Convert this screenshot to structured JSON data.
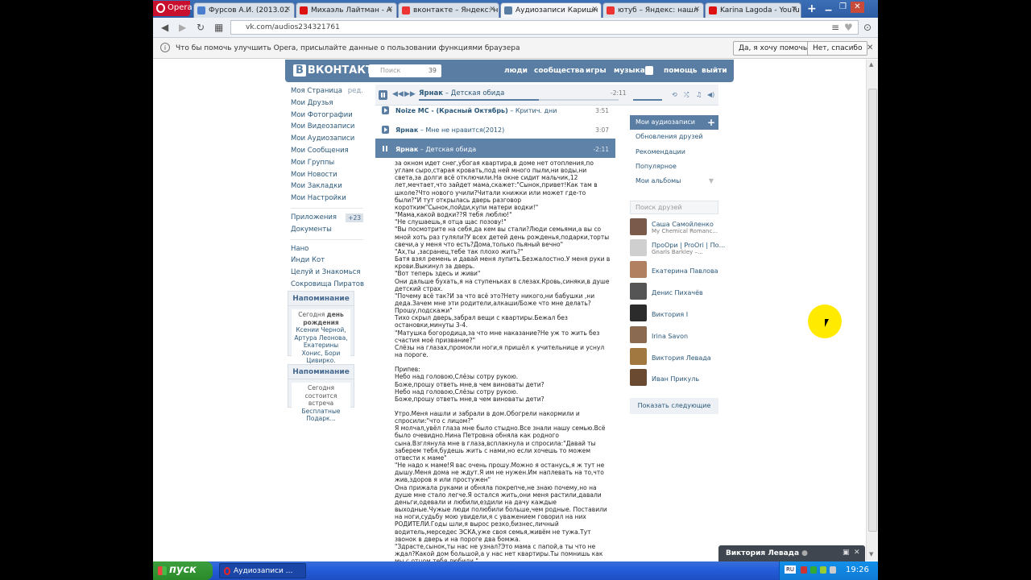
{
  "browser": {
    "menu_label": "Opera",
    "tabs": [
      {
        "title": "Фурсов А.И. (2013.02",
        "color": "#4a7fd0"
      },
      {
        "title": "Михаэль Лайтман - А",
        "color": "#d11"
      },
      {
        "title": "вконтакте – Яндекс: н",
        "color": "#e33"
      },
      {
        "title": "Аудиозаписи Каришн",
        "color": "#597da3"
      },
      {
        "title": "ютуб – Яндекс: нашл",
        "color": "#e33"
      },
      {
        "title": "Karina Lagoda - YouTu",
        "color": "#d11"
      }
    ],
    "url": "vk.com/audios234321761",
    "infobar": {
      "message": "Что бы помочь улучшить Opera, присылайте данные о пользовании функциями браузера",
      "yes_label": "Да, я хочу помочь",
      "no_label": "Нет, спасибо"
    }
  },
  "vk": {
    "logo": "ВКОНТАКТЕ",
    "logo_mark": "В",
    "search_placeholder": "Поиск",
    "search_count": "39",
    "nav": [
      "люди",
      "сообщества",
      "игры",
      "музыка",
      "помощь",
      "выйти"
    ],
    "left_menu": [
      {
        "label": "Моя Страница",
        "extra": "ред."
      },
      {
        "label": "Мои Друзья"
      },
      {
        "label": "Мои Фотографии"
      },
      {
        "label": "Мои Видеозаписи"
      },
      {
        "label": "Мои Аудиозаписи"
      },
      {
        "label": "Мои Сообщения"
      },
      {
        "label": "Мои Группы"
      },
      {
        "label": "Мои Новости"
      },
      {
        "label": "Мои Закладки"
      },
      {
        "label": "Мои Настройки"
      }
    ],
    "apps": {
      "label": "Приложения",
      "badge": "+23"
    },
    "docs": "Документы",
    "groups": [
      "Нано",
      "Инди Кот",
      "Целуй и Знакомься",
      "Сокровища Пиратов"
    ],
    "reminder1": {
      "title": "Напоминание",
      "pre": "Сегодня",
      "bold": "день рождения",
      "names": "Ксении Черной, Артура Леонова, Екатерины Хонис, Бори Цивирко."
    },
    "reminder2": {
      "title": "Напоминание",
      "text": "Сегодня состоится встреча",
      "link": "Бесплатные Подарк..."
    },
    "player": {
      "artist": "Ярнак",
      "title": "Детская обида",
      "time": "-2:11",
      "progress": 0.6
    },
    "tracks": [
      {
        "artist": "Noize MC - (Красный Октябрь)",
        "title": "Критич. дни",
        "duration": "3:51"
      },
      {
        "artist": "Ярнак",
        "title": "Мне не нравится(2012)",
        "duration": "3:07"
      },
      {
        "artist": "Ярнак",
        "title": "Детская обида",
        "duration": "-2:11"
      }
    ],
    "lyrics": [
      "за окном идет снег,убогая квартира,в доме нет отопления,по углам сыро,старая кровать,под ней много пыли,ни воды,ни света,за долги всё отключили.На окне сидит мальчик,12 лет,мечтает,что зайдет мама,скажет:\"Сынок,привет!Как там в школе?Что нового учили?Читали книжки или может где-то были?\"И тут открылась дверь разговор коротким\"Сынок,пойди,купи матери водки!\"\n\"Мама,какой водки??Я тебя люблю!\"\n\"Не слушаешь,я отца щас позову!\"\n\"Вы посмотрите на себя,да кем вы стали?Люди семьями,а вы со мной хоть раз гуляли?У всех детей день рожденья,подарки,торты свечи,а у меня что есть?Дома,только пьяный вечно\"\n\"Ах,ты ,засранец,тебе так плохо жить?\"\nБатя взял ремень и давай меня лупить.Безжалостно.У меня руки в крови.Выкинул за дверь.\n\"Вот теперь здесь и живи\"\nОни дальше бухать,я на ступеньках в слезах.Кровь,синяки,в душе детский страх.\n\"Почему всё так?И за что всё это?Нету никого,ни бабушки ,ни деда.Зачем мне эти родители,алкаши/Боже что мне делать?Прошу,подскажи\"\nТихо скрыл дверь,забрал вещи с квартиры.Бежал без остановки,минуты 3-4.\n\"Матушка богородица,за что мне наказание?Не уж то жить без счастия моё призвание?\"\nСлёзы на глазах,промокли ноги,я пришёл к учительнице и уснул на пороге.",
      "Припев:\nНебо над головою,Слёзы сотру рукою.\nБоже,прошу ответь мне,в чем виноваты дети?\nНебо над головою,Слёзы сотру рукою.\nБоже,прошу ответь мне,в чем виноваты дети?",
      "Утро.Меня нашли и забрали в дом.Обогрели накормили и спросили:\"что с лицом?\"\nЯ молчал,увёл глаза мне было стыдно.Все знали нашу семью.Всё было очевидно.Нина Петровна обняла как родного сына.Взглянула мне в глаза,всплакнула и спросила:\"Давай ты заберем тебя,будешь жить с нами,но если хочешь то можем отвести к маме\"\n\"Не надо к маме!Я вас очень прошу.Можно я останусь,я ж тут не дышу.Меня дома не ждут.Я им не нужен.Им наплевать на то,что жив,здоров я или простужен\"\nОна прижала руками и обняла покрепче,не знаю почему,но на душе мне стало легче.Я остался жить,они меня растили,давали деньги,одевали и любили,ездили на дачу каждые выходные.Чужые люди полюбили больше,чем родные. Поставили на ноги,судьбу мою увидели,я с уважением говорил на них РОДИТЕЛИ.Годы шли,я вырос резко,бизнес,личный водитель,мерседес ЭСКА,уже своя семья,живём не тужа.Тут звонок в дверь и на пороге два бомжа.\n\"Здрасте,сынок,ты нас не узнал?Это мама с папой,а ты что не ждал?Какой дом большой,а у нас нет квартиры.Ты помнишь как мы с отцом тебя любили.\"\nЯ смотрю им в глаза-детская обида.\n\"Папа,это кто?\"-спросила дочка рита."
    ],
    "right_menu": [
      "Мои аудиозаписи",
      "Обновления друзей",
      "Рекомендации",
      "Популярное",
      "Мои альбомы"
    ],
    "friends_search_placeholder": "Поиск друзей",
    "friends": [
      {
        "name": "Саша Самойленко",
        "sub": "My Chemical Romanc...",
        "color": "#7a5a4a"
      },
      {
        "name": "ПроОри | ProOri | По...",
        "sub": "Gnarls Barkley –...",
        "color": "#cfcfcf"
      },
      {
        "name": "Екатерина Павлова",
        "sub": "",
        "color": "#b08060"
      },
      {
        "name": "Денис Пихачёв",
        "sub": "",
        "color": "#555"
      },
      {
        "name": "Виктория I",
        "sub": "",
        "color": "#2b2b2b"
      },
      {
        "name": "Irina Savon",
        "sub": "",
        "color": "#8a6a50"
      },
      {
        "name": "Виктория Левада",
        "sub": "",
        "color": "#a07840"
      },
      {
        "name": "Иван Прикуль",
        "sub": "",
        "color": "#6a4a30"
      }
    ],
    "show_more": "Показать следующие",
    "chat_popup": "Виктория Левада"
  },
  "taskbar": {
    "start": "пуск",
    "item": "Аудиозаписи ...",
    "lang": "RU",
    "clock": "19:26"
  }
}
